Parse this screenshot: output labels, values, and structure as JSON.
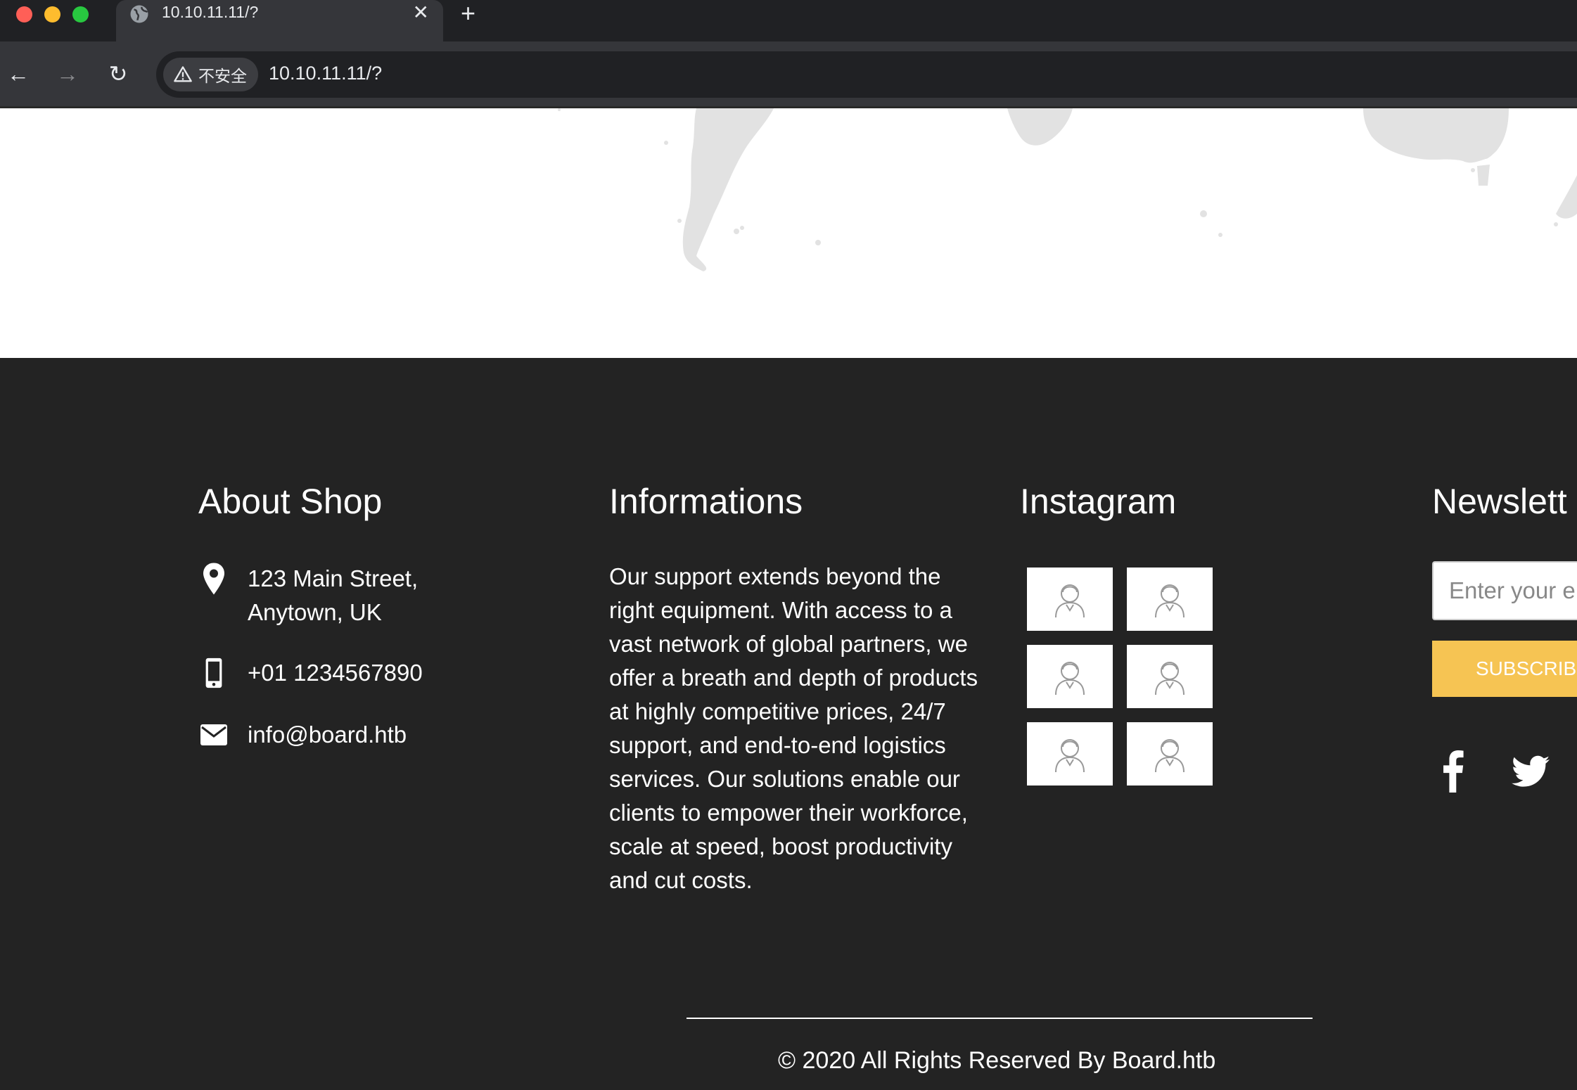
{
  "browser": {
    "tab_title": "10.10.11.11/?",
    "tab_close": "✕",
    "new_tab": "+",
    "security_label": "不安全",
    "url": "10.10.11.11/?",
    "back": "←",
    "forward": "→",
    "reload": "↻"
  },
  "footer": {
    "about": {
      "title": "About Shop",
      "address_line1": "123 Main Street,",
      "address_line2": "Anytown, UK",
      "phone": "+01 1234567890",
      "email": "info@board.htb"
    },
    "informations": {
      "title": "Informations",
      "text": "Our support extends beyond the right equipment. With access to a vast network of global partners, we offer a breath and depth of products at highly competitive prices, 24/7 support, and end-to-end logistics services. Our solutions enable our clients to empower their workforce, scale at speed, boost productivity and cut costs."
    },
    "instagram": {
      "title": "Instagram",
      "thumbnails": [
        "avatar-icon",
        "avatar-icon",
        "avatar-icon",
        "avatar-icon",
        "avatar-icon",
        "avatar-icon"
      ]
    },
    "newsletter": {
      "title": "Newslett",
      "email_placeholder": "Enter your e",
      "subscribe_label": "SUBSCRIB",
      "social": [
        "facebook-icon",
        "twitter-icon"
      ]
    },
    "copyright": "© 2020 All Rights Reserved By Board.htb"
  },
  "colors": {
    "footer_bg": "#232323",
    "accent": "#f6c453",
    "map_land": "#e2e2e2"
  }
}
